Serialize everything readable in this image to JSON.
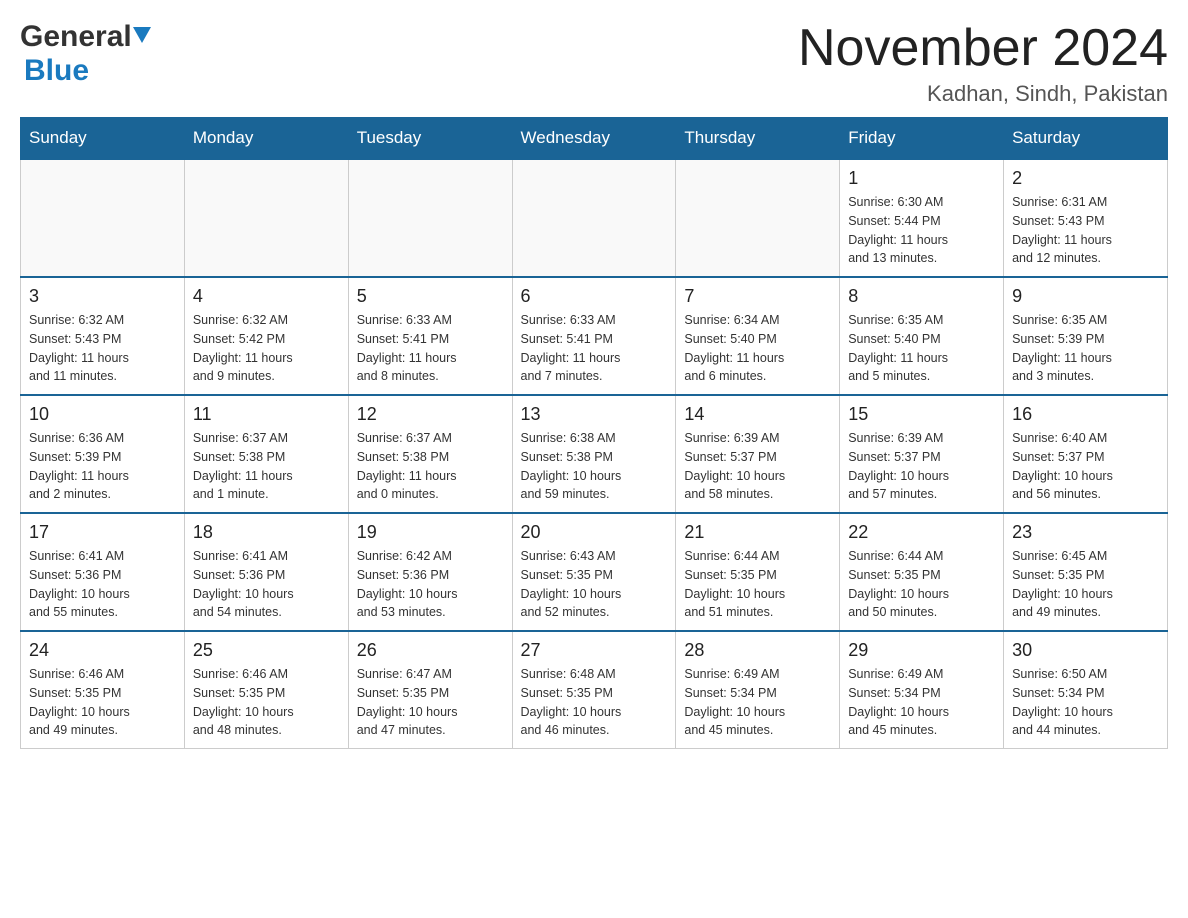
{
  "header": {
    "month_year": "November 2024",
    "location": "Kadhan, Sindh, Pakistan",
    "logo_general": "General",
    "logo_blue": "Blue"
  },
  "days_of_week": [
    "Sunday",
    "Monday",
    "Tuesday",
    "Wednesday",
    "Thursday",
    "Friday",
    "Saturday"
  ],
  "weeks": [
    [
      {
        "day": "",
        "info": ""
      },
      {
        "day": "",
        "info": ""
      },
      {
        "day": "",
        "info": ""
      },
      {
        "day": "",
        "info": ""
      },
      {
        "day": "",
        "info": ""
      },
      {
        "day": "1",
        "info": "Sunrise: 6:30 AM\nSunset: 5:44 PM\nDaylight: 11 hours\nand 13 minutes."
      },
      {
        "day": "2",
        "info": "Sunrise: 6:31 AM\nSunset: 5:43 PM\nDaylight: 11 hours\nand 12 minutes."
      }
    ],
    [
      {
        "day": "3",
        "info": "Sunrise: 6:32 AM\nSunset: 5:43 PM\nDaylight: 11 hours\nand 11 minutes."
      },
      {
        "day": "4",
        "info": "Sunrise: 6:32 AM\nSunset: 5:42 PM\nDaylight: 11 hours\nand 9 minutes."
      },
      {
        "day": "5",
        "info": "Sunrise: 6:33 AM\nSunset: 5:41 PM\nDaylight: 11 hours\nand 8 minutes."
      },
      {
        "day": "6",
        "info": "Sunrise: 6:33 AM\nSunset: 5:41 PM\nDaylight: 11 hours\nand 7 minutes."
      },
      {
        "day": "7",
        "info": "Sunrise: 6:34 AM\nSunset: 5:40 PM\nDaylight: 11 hours\nand 6 minutes."
      },
      {
        "day": "8",
        "info": "Sunrise: 6:35 AM\nSunset: 5:40 PM\nDaylight: 11 hours\nand 5 minutes."
      },
      {
        "day": "9",
        "info": "Sunrise: 6:35 AM\nSunset: 5:39 PM\nDaylight: 11 hours\nand 3 minutes."
      }
    ],
    [
      {
        "day": "10",
        "info": "Sunrise: 6:36 AM\nSunset: 5:39 PM\nDaylight: 11 hours\nand 2 minutes."
      },
      {
        "day": "11",
        "info": "Sunrise: 6:37 AM\nSunset: 5:38 PM\nDaylight: 11 hours\nand 1 minute."
      },
      {
        "day": "12",
        "info": "Sunrise: 6:37 AM\nSunset: 5:38 PM\nDaylight: 11 hours\nand 0 minutes."
      },
      {
        "day": "13",
        "info": "Sunrise: 6:38 AM\nSunset: 5:38 PM\nDaylight: 10 hours\nand 59 minutes."
      },
      {
        "day": "14",
        "info": "Sunrise: 6:39 AM\nSunset: 5:37 PM\nDaylight: 10 hours\nand 58 minutes."
      },
      {
        "day": "15",
        "info": "Sunrise: 6:39 AM\nSunset: 5:37 PM\nDaylight: 10 hours\nand 57 minutes."
      },
      {
        "day": "16",
        "info": "Sunrise: 6:40 AM\nSunset: 5:37 PM\nDaylight: 10 hours\nand 56 minutes."
      }
    ],
    [
      {
        "day": "17",
        "info": "Sunrise: 6:41 AM\nSunset: 5:36 PM\nDaylight: 10 hours\nand 55 minutes."
      },
      {
        "day": "18",
        "info": "Sunrise: 6:41 AM\nSunset: 5:36 PM\nDaylight: 10 hours\nand 54 minutes."
      },
      {
        "day": "19",
        "info": "Sunrise: 6:42 AM\nSunset: 5:36 PM\nDaylight: 10 hours\nand 53 minutes."
      },
      {
        "day": "20",
        "info": "Sunrise: 6:43 AM\nSunset: 5:35 PM\nDaylight: 10 hours\nand 52 minutes."
      },
      {
        "day": "21",
        "info": "Sunrise: 6:44 AM\nSunset: 5:35 PM\nDaylight: 10 hours\nand 51 minutes."
      },
      {
        "day": "22",
        "info": "Sunrise: 6:44 AM\nSunset: 5:35 PM\nDaylight: 10 hours\nand 50 minutes."
      },
      {
        "day": "23",
        "info": "Sunrise: 6:45 AM\nSunset: 5:35 PM\nDaylight: 10 hours\nand 49 minutes."
      }
    ],
    [
      {
        "day": "24",
        "info": "Sunrise: 6:46 AM\nSunset: 5:35 PM\nDaylight: 10 hours\nand 49 minutes."
      },
      {
        "day": "25",
        "info": "Sunrise: 6:46 AM\nSunset: 5:35 PM\nDaylight: 10 hours\nand 48 minutes."
      },
      {
        "day": "26",
        "info": "Sunrise: 6:47 AM\nSunset: 5:35 PM\nDaylight: 10 hours\nand 47 minutes."
      },
      {
        "day": "27",
        "info": "Sunrise: 6:48 AM\nSunset: 5:35 PM\nDaylight: 10 hours\nand 46 minutes."
      },
      {
        "day": "28",
        "info": "Sunrise: 6:49 AM\nSunset: 5:34 PM\nDaylight: 10 hours\nand 45 minutes."
      },
      {
        "day": "29",
        "info": "Sunrise: 6:49 AM\nSunset: 5:34 PM\nDaylight: 10 hours\nand 45 minutes."
      },
      {
        "day": "30",
        "info": "Sunrise: 6:50 AM\nSunset: 5:34 PM\nDaylight: 10 hours\nand 44 minutes."
      }
    ]
  ]
}
